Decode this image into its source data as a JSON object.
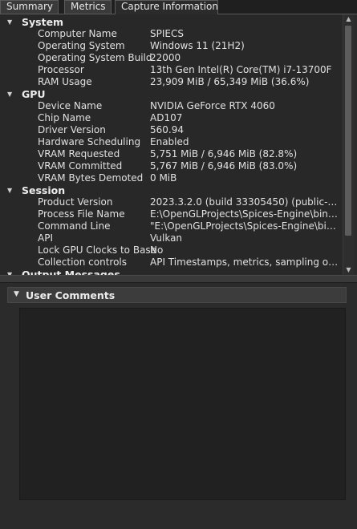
{
  "tabs": [
    {
      "label": "Summary"
    },
    {
      "label": "Metrics"
    },
    {
      "label": "Capture Information"
    }
  ],
  "sections": [
    {
      "title": "System",
      "items": [
        {
          "key": "Computer Name",
          "value": "SPIECS"
        },
        {
          "key": "Operating System",
          "value": "Windows 11 (21H2)"
        },
        {
          "key": "Operating System Build",
          "value": "22000"
        },
        {
          "key": "Processor",
          "value": "13th Gen Intel(R) Core(TM) i7-13700F"
        },
        {
          "key": "RAM Usage",
          "value": "23,909 MiB / 65,349 MiB (36.6%)"
        }
      ]
    },
    {
      "title": "GPU",
      "items": [
        {
          "key": "Device Name",
          "value": "NVIDIA GeForce RTX 4060"
        },
        {
          "key": "Chip Name",
          "value": "AD107"
        },
        {
          "key": "Driver Version",
          "value": "560.94"
        },
        {
          "key": "Hardware Scheduling",
          "value": "Enabled"
        },
        {
          "key": "VRAM Requested",
          "value": "5,751 MiB / 6,946 MiB (82.8%)"
        },
        {
          "key": "VRAM Committed",
          "value": "5,767 MiB / 6,946 MiB (83.0%)"
        },
        {
          "key": "VRAM Bytes Demoted",
          "value": "0 MiB"
        }
      ]
    },
    {
      "title": "Session",
      "items": [
        {
          "key": "Product Version",
          "value": "2023.3.2.0 (build 33305450) (public-relea..."
        },
        {
          "key": "Process File Name",
          "value": "E:\\OpenGLProjects\\Spices-Engine\\bin\\De..."
        },
        {
          "key": "Command Line",
          "value": "\"E:\\OpenGLProjects\\Spices-Engine\\bin\\De..."
        },
        {
          "key": "API",
          "value": "Vulkan"
        },
        {
          "key": "Lock GPU Clocks to Base",
          "value": "No"
        },
        {
          "key": "Collection controls",
          "value": "API Timestamps, metrics, sampling oldes..."
        }
      ]
    },
    {
      "title": "Output Messages",
      "items": []
    }
  ],
  "user_comments": {
    "title": "User Comments",
    "text": ""
  },
  "icons": {
    "expanded_arrow": "triangle-down-icon",
    "scroll_up": "scroll-up-arrow-icon",
    "scroll_down": "scroll-down-arrow-icon"
  },
  "colors": {
    "background": "#2b2b2b",
    "panel": "#282828",
    "text": "#e0e0e0",
    "comment_area": "#212121"
  }
}
